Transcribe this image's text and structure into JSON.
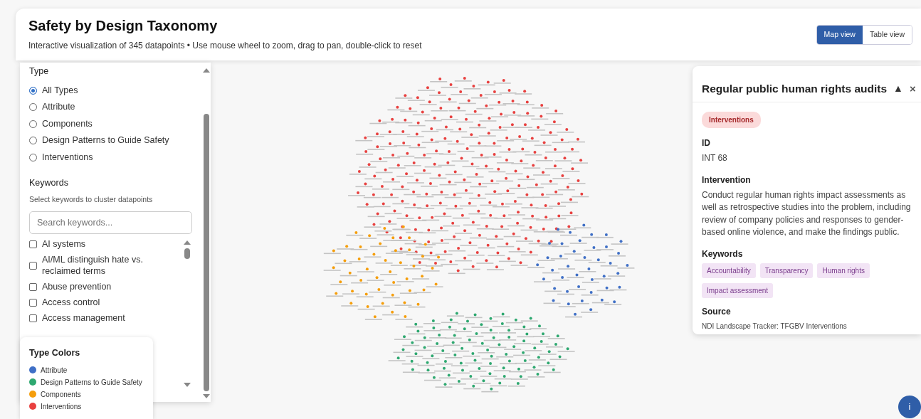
{
  "header": {
    "title": "Safety by Design Taxonomy",
    "subtitle": "Interactive visualization of 345 datapoints • Use mouse wheel to zoom, drag to pan, double-click to reset"
  },
  "view_toggle": [
    {
      "label": "Map view",
      "selected": true
    },
    {
      "label": "Table view",
      "selected": false
    }
  ],
  "filters": {
    "type_heading": "Type",
    "types": [
      {
        "label": "All Types",
        "selected": true
      },
      {
        "label": "Attribute",
        "selected": false
      },
      {
        "label": "Components",
        "selected": false
      },
      {
        "label": "Design Patterns to Guide Safety",
        "selected": false
      },
      {
        "label": "Interventions",
        "selected": false
      }
    ],
    "keywords_heading": "Keywords",
    "keywords_hint": "Select keywords to cluster datapoints",
    "search": {
      "placeholder": "Search keywords..."
    },
    "keywords": [
      {
        "label": "AI systems",
        "checked": false
      },
      {
        "label": "AI/ML distinguish hate vs. reclaimed terms",
        "checked": false
      },
      {
        "label": "Abuse prevention",
        "checked": false
      },
      {
        "label": "Access control",
        "checked": false
      },
      {
        "label": "Access management",
        "checked": false
      }
    ]
  },
  "legend": {
    "title": "Type Colors",
    "items": [
      {
        "label": "Attribute",
        "color": "#3f6fc6"
      },
      {
        "label": "Design Patterns to Guide Safety",
        "color": "#2ea870"
      },
      {
        "label": "Components",
        "color": "#f59e0b"
      },
      {
        "label": "Interventions",
        "color": "#e8403f"
      }
    ]
  },
  "detail": {
    "title": "Regular public human rights audits",
    "collapse": "▲",
    "close": "×",
    "type_badge": "Interventions",
    "fields": [
      {
        "label": "ID",
        "value": "INT 68"
      },
      {
        "label": "Intervention",
        "value": "Conduct regular human rights impact assessments as well as retrospective studies into the problem, including review of company policies and responses to gender-based online violence, and make the findings public."
      }
    ],
    "keywords_label": "Keywords",
    "keywords": [
      "Accountability",
      "Transparency",
      "Human rights",
      "Impact assessment"
    ],
    "source_label": "Source",
    "source": "NDI Landscape Tracker: TFGBV Interventions"
  },
  "info_button": "i"
}
